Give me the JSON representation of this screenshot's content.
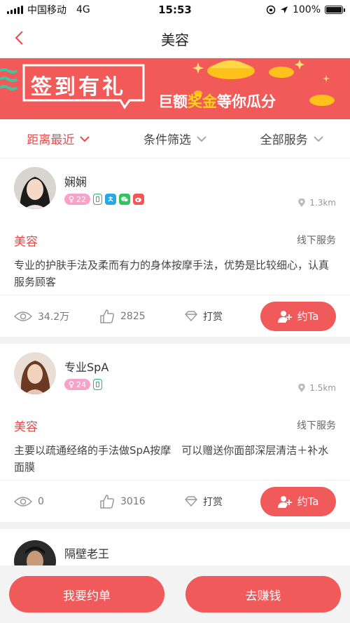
{
  "status": {
    "carrier": "中国移动",
    "network": "4G",
    "time": "15:53",
    "battery": "100%",
    "battery_level": 1.0
  },
  "nav": {
    "title": "美容"
  },
  "banner": {
    "left_text": "签到有礼",
    "right_text_1": "巨额",
    "right_text_highlight": "奖金",
    "right_text_2": "等你瓜分"
  },
  "filters": [
    {
      "label": "距离最近",
      "active": true
    },
    {
      "label": "条件筛选",
      "active": false
    },
    {
      "label": "全部服务",
      "active": false
    }
  ],
  "cards": [
    {
      "name": "娴娴",
      "age": "22",
      "distance": "1.3km",
      "category": "美容",
      "service_type": "线下服务",
      "desc": "专业的护肤手法及柔而有力的身体按摩手法，优势是比较细心，认真服务顾客",
      "views": "34.2万",
      "likes": "2825",
      "tip": "打赏",
      "book": "约Ta"
    },
    {
      "name": "专业SpA",
      "age": "24",
      "distance": "1.5km",
      "category": "美容",
      "service_type": "线下服务",
      "desc": "主要以疏通经络的手法做SpA按摩　可以赠送你面部深层清洁＋补水面膜",
      "views": "0",
      "likes": "3016",
      "tip": "打赏",
      "book": "约Ta"
    },
    {
      "name": "隔壁老王"
    }
  ],
  "bottom": {
    "order_btn": "我要约单",
    "earn_btn": "去赚钱"
  },
  "colors": {
    "accent": "#f05a5a",
    "active_filter": "#e84a4a",
    "banner_bg": "#f25a5a"
  }
}
